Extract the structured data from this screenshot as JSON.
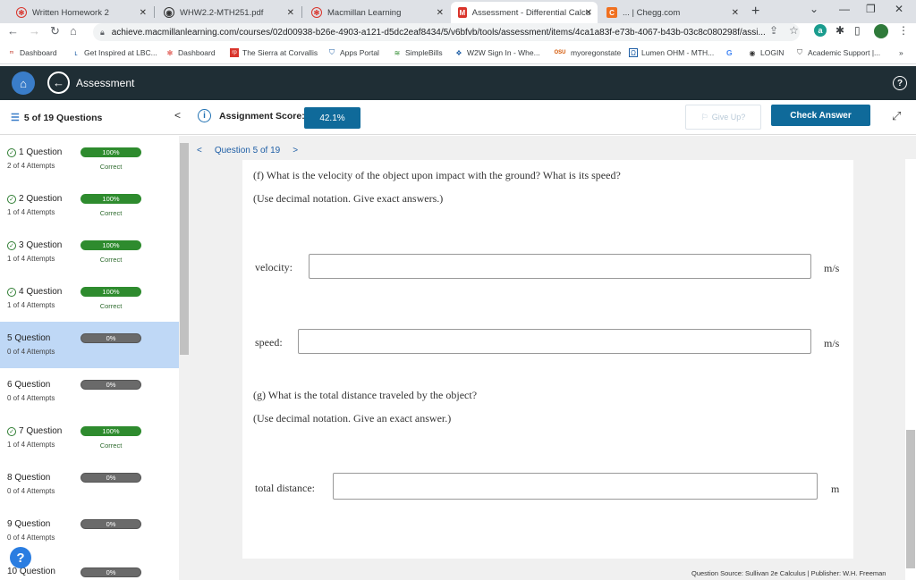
{
  "browser": {
    "tabs": [
      {
        "title": "Written Homework 2"
      },
      {
        "title": "WHW2.2-MTH251.pdf"
      },
      {
        "title": "Macmillan Learning"
      },
      {
        "title": "Assessment - Differential Calcu"
      },
      {
        "title": "... | Chegg.com"
      }
    ],
    "url": "achieve.macmillanlearning.com/courses/02d00938-b26e-4903-a121-d5dc2eaf8434/5/v6bfvb/tools/assessment/items/4ca1a83f-e73b-4067-b43b-03c8c080298f/assi...",
    "bookmarks": [
      "Dashboard",
      "Get Inspired at LBC...",
      "Dashboard",
      "The Sierra at Corvallis",
      "Apps Portal",
      "SimpleBills",
      "W2W Sign In - Whe...",
      "myoregonstate",
      "Lumen OHM - MTH...",
      "LOGIN",
      "Academic Support |..."
    ]
  },
  "header": {
    "title": "Assessment"
  },
  "subheader": {
    "question_count": "5 of 19 Questions",
    "score_label": "Assignment Score:",
    "score_value": "42.1%",
    "give_up": "Give Up?",
    "check_answer": "Check Answer"
  },
  "sidebar": {
    "items": [
      {
        "name": "1 Question",
        "attempts": "2 of 4 Attempts",
        "score": "100%",
        "status": "Correct",
        "done": true
      },
      {
        "name": "2 Question",
        "attempts": "1 of 4 Attempts",
        "score": "100%",
        "status": "Correct",
        "done": true
      },
      {
        "name": "3 Question",
        "attempts": "1 of 4 Attempts",
        "score": "100%",
        "status": "Correct",
        "done": true
      },
      {
        "name": "4 Question",
        "attempts": "1 of 4 Attempts",
        "score": "100%",
        "status": "Correct",
        "done": true
      },
      {
        "name": "5 Question",
        "attempts": "0 of 4 Attempts",
        "score": "0%",
        "status": "",
        "done": false
      },
      {
        "name": "6 Question",
        "attempts": "0 of 4 Attempts",
        "score": "0%",
        "status": "",
        "done": false
      },
      {
        "name": "7 Question",
        "attempts": "1 of 4 Attempts",
        "score": "100%",
        "status": "Correct",
        "done": true
      },
      {
        "name": "8 Question",
        "attempts": "0 of 4 Attempts",
        "score": "0%",
        "status": "",
        "done": false
      },
      {
        "name": "9 Question",
        "attempts": "0 of 4 Attempts",
        "score": "0%",
        "status": "",
        "done": false
      },
      {
        "name": "10 Question",
        "attempts": "",
        "score": "0%",
        "status": "",
        "done": false
      }
    ]
  },
  "main": {
    "question_nav": "Question 5 of 19",
    "part_f": "(f) What is the velocity of the object upon impact with the ground? What is its speed?",
    "part_f_note": "(Use decimal notation. Give exact answers.)",
    "velocity_label": "velocity:",
    "velocity_unit": "m/s",
    "speed_label": "speed:",
    "speed_unit": "m/s",
    "part_g": "(g) What is the total distance traveled by the object?",
    "part_g_note": "(Use decimal notation. Give an exact answer.)",
    "distance_label": "total distance:",
    "distance_unit": "m",
    "source": "Question Source: Sullivan 2e Calculus  |  Publisher: W.H. Freeman"
  }
}
